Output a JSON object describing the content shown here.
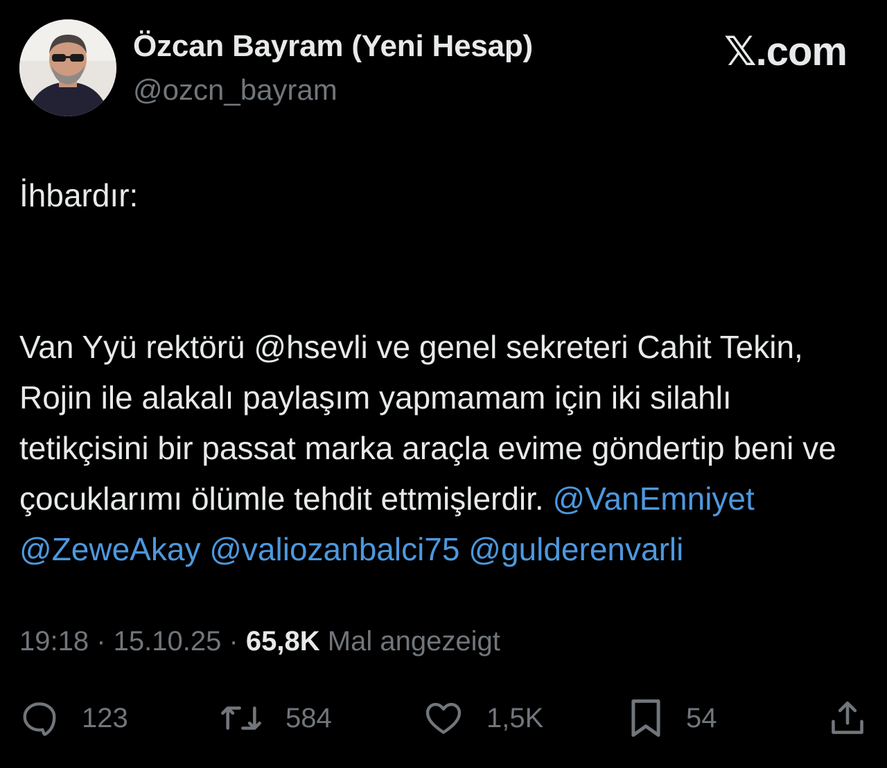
{
  "author": {
    "name": "Özcan Bayram (Yeni Hesap)",
    "handle": "@ozcn_bayram",
    "avatar_icon": "profile-photo"
  },
  "brand": "𝕏.com",
  "tweet": {
    "line1": "İhbardır:",
    "text_plain": "Van Yyü rektörü @hsevli ve genel sekreteri Cahit Tekin, Rojin ile alakalı paylaşım yapmamam için iki silahlı tetikçisini bir passat marka araçla evime göndertip beni ve çocuklarımı ölümle tehdit ettmişlerdir.",
    "mentions": [
      "@VanEmniyet",
      "@ZeweAkay",
      "@valiozanbalci75",
      "@gulderenvarli"
    ]
  },
  "meta": {
    "time": "19:18",
    "separator": " · ",
    "date": "15.10.25",
    "views": "65,8K",
    "views_label": "Mal angezeigt"
  },
  "actions": {
    "reply": {
      "icon": "reply-icon",
      "count": "123"
    },
    "repost": {
      "icon": "repost-icon",
      "count": "584"
    },
    "like": {
      "icon": "heart-icon",
      "count": "1,5K"
    },
    "bookmark": {
      "icon": "bookmark-icon",
      "count": "54"
    },
    "share": {
      "icon": "share-icon"
    }
  },
  "colors": {
    "background": "#000000",
    "text": "#e7e9ea",
    "muted": "#71767b",
    "link": "#4d98de"
  }
}
